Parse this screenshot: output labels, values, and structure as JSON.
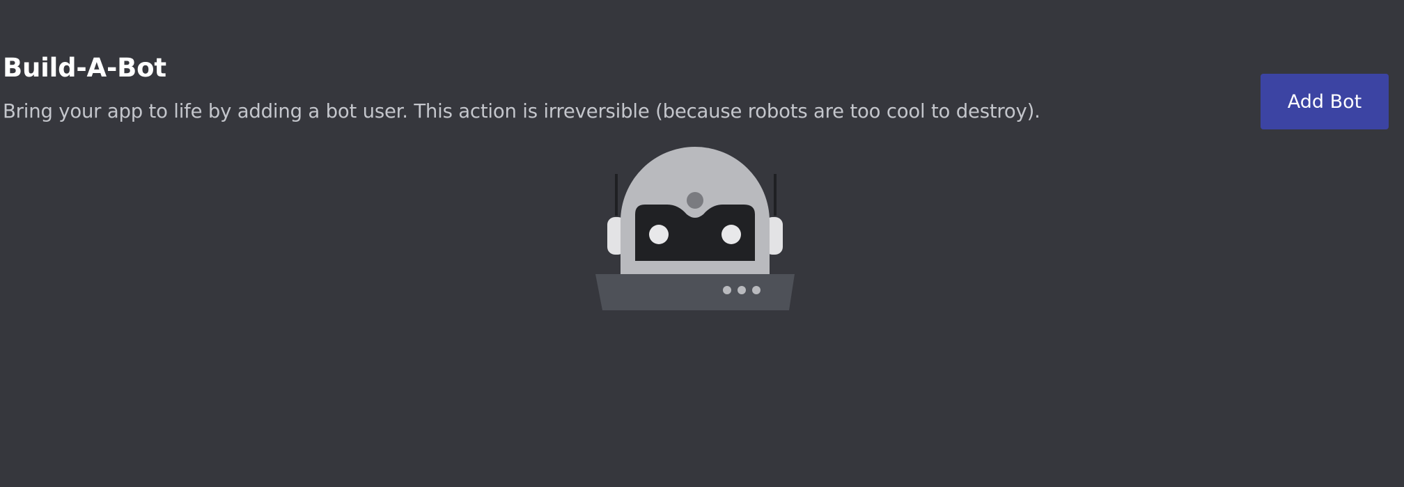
{
  "section": {
    "title": "Build-A-Bot",
    "description": "Bring your app to life by adding a bot user. This action is irreversible (because robots are too cool to destroy)."
  },
  "actions": {
    "add_bot_label": "Add Bot"
  },
  "illustration": {
    "icon": "robot-illustration",
    "colors": {
      "head": "#b9babe",
      "visor": "#202124",
      "eyes": "#e8e8ea",
      "base": "#4e5158",
      "antenna": "#1f2023"
    }
  },
  "theme": {
    "background": "#36373d",
    "accent": "#3c44a3",
    "text_primary": "#ffffff",
    "text_secondary": "#c4c6cc"
  }
}
